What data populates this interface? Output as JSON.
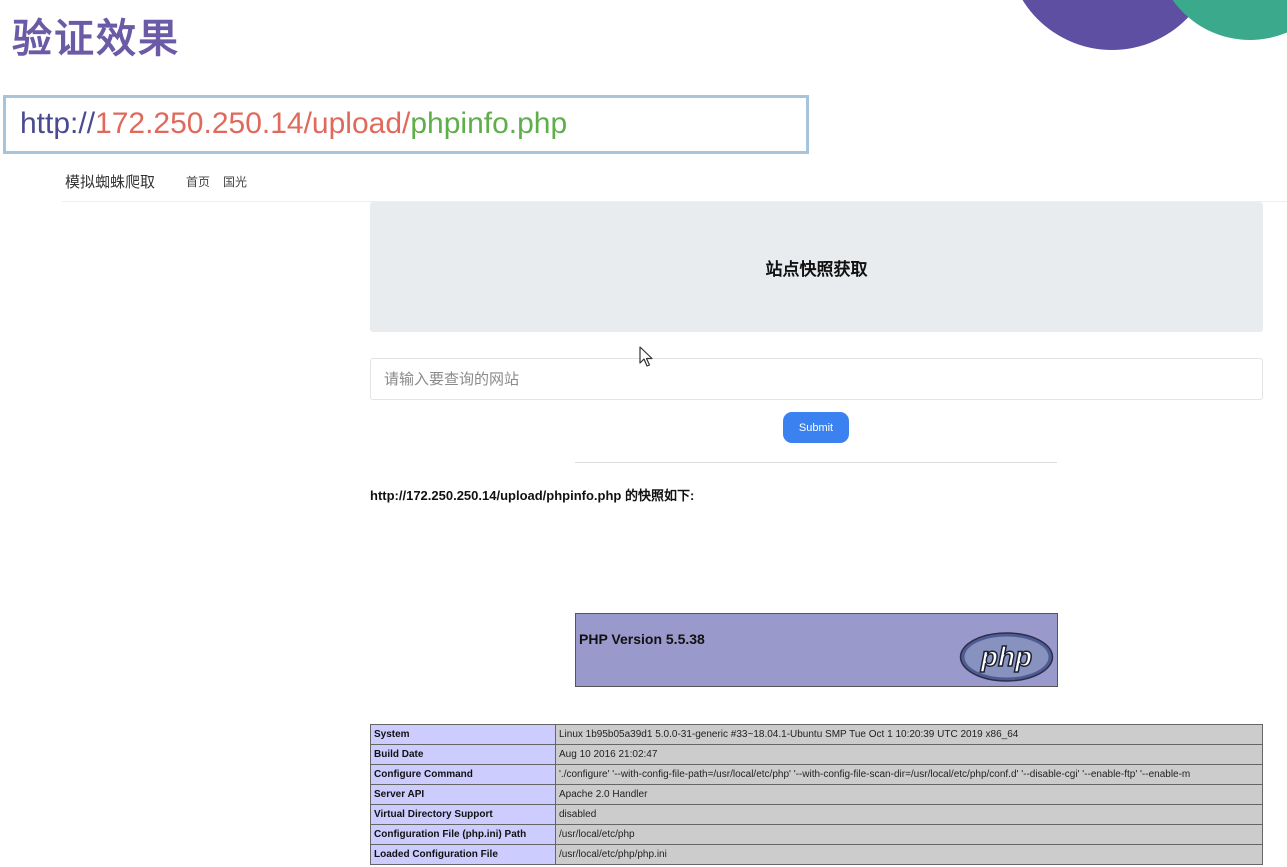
{
  "slide": {
    "title": "验证效果",
    "url_parts": [
      "http://",
      "172.250.250.14/upload/",
      "phpinfo.php"
    ],
    "colors": {
      "title": "#6b5aa6",
      "deco_purple": "#5e4fa2",
      "deco_green": "#3aa98c"
    }
  },
  "app": {
    "brand": "模拟蜘蛛爬取",
    "nav": {
      "home": "首页",
      "guoguang": "国光"
    },
    "jumbotron_title": "站点快照获取",
    "search": {
      "placeholder": "请输入要查询的网站",
      "value": ""
    },
    "submit_label": "Submit",
    "result_title": "http://172.250.250.14/upload/phpinfo.php 的快照如下:"
  },
  "phpinfo": {
    "version": "PHP Version 5.5.38",
    "logo_text": "php",
    "rows": [
      {
        "key": "System",
        "value": "Linux 1b95b05a39d1 5.0.0-31-generic #33~18.04.1-Ubuntu SMP Tue Oct 1 10:20:39 UTC 2019 x86_64"
      },
      {
        "key": "Build Date",
        "value": "Aug 10 2016 21:02:47"
      },
      {
        "key": "Configure Command",
        "value": " './configure' '--with-config-file-path=/usr/local/etc/php' '--with-config-file-scan-dir=/usr/local/etc/php/conf.d' '--disable-cgi' '--enable-ftp' '--enable-m"
      },
      {
        "key": "Server API",
        "value": "Apache 2.0 Handler"
      },
      {
        "key": "Virtual Directory Support",
        "value": "disabled"
      },
      {
        "key": "Configuration File (php.ini) Path",
        "value": "/usr/local/etc/php"
      },
      {
        "key": "Loaded Configuration File",
        "value": "/usr/local/etc/php/php.ini"
      }
    ],
    "colors": {
      "header": "#9999cc",
      "key": "#ccccff",
      "value": "#cccccc"
    }
  }
}
